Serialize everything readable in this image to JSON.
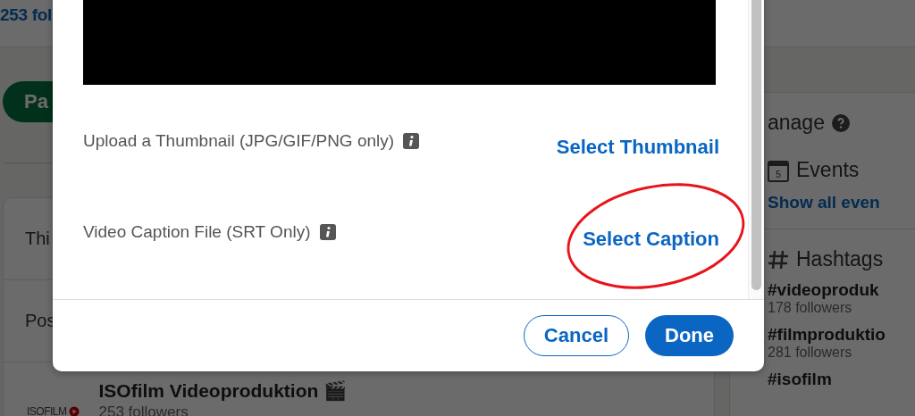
{
  "page": {
    "follower_count": "253 fol",
    "pill": "Pa",
    "card_rows": [
      "Thi",
      "Pos"
    ],
    "entity": {
      "logo": "ISOFILM",
      "name": "ISOfilm Videoproduktion 🎬",
      "followers": "253 followers"
    },
    "sidebar": {
      "manage": "anage",
      "events_title": "Events",
      "calendar_day": "5",
      "events_link": "Show all even",
      "hashtags_title": "Hashtags",
      "hashtags": [
        {
          "tag": "#videoproduk",
          "followers": "178 followers"
        },
        {
          "tag": "#filmproduktio",
          "followers": "281 followers"
        },
        {
          "tag": "#isofilm"
        }
      ]
    }
  },
  "dialog": {
    "rows": [
      {
        "label": "Upload a Thumbnail (JPG/GIF/PNG only)",
        "action": "Select Thumbnail",
        "highlighted": false
      },
      {
        "label": "Video Caption File (SRT Only)",
        "action": "Select Caption",
        "highlighted": true
      }
    ],
    "buttons": [
      {
        "label": "Cancel",
        "kind": "secondary"
      },
      {
        "label": "Done",
        "kind": "primary"
      }
    ]
  }
}
